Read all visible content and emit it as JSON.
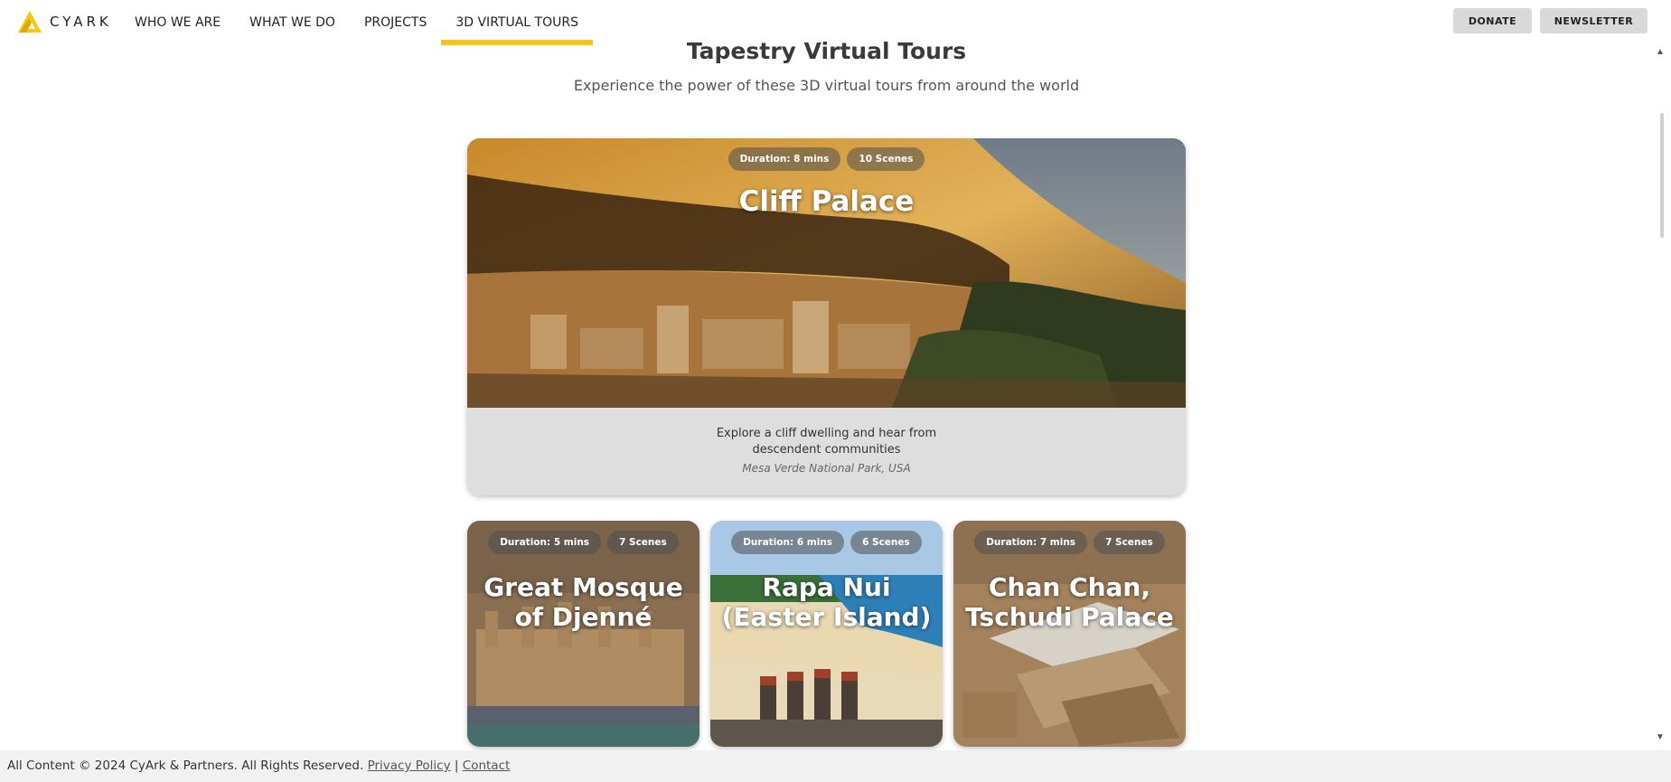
{
  "brand": {
    "name": "CYARK",
    "accent": "#f5c518"
  },
  "nav": {
    "items": [
      {
        "label": "WHO WE ARE"
      },
      {
        "label": "WHAT WE DO"
      },
      {
        "label": "PROJECTS"
      },
      {
        "label": "3D VIRTUAL TOURS",
        "active": true
      }
    ]
  },
  "header_buttons": {
    "donate": "DONATE",
    "newsletter": "NEWSLETTER"
  },
  "page": {
    "title": "Tapestry Virtual Tours",
    "subtitle": "Experience the power of these 3D virtual tours from around the world"
  },
  "featured": {
    "duration": "Duration: 8 mins",
    "scenes": "10 Scenes",
    "title": "Cliff Palace",
    "description_line1": "Explore a cliff dwelling and hear from",
    "description_line2": "descendent communities",
    "location": "Mesa Verde National Park, USA"
  },
  "tours": [
    {
      "duration": "Duration: 5 mins",
      "scenes": "7 Scenes",
      "title_line1": "Great Mosque",
      "title_line2": "of Djenné"
    },
    {
      "duration": "Duration: 6 mins",
      "scenes": "6 Scenes",
      "title_line1": "Rapa Nui",
      "title_line2": "(Easter Island)"
    },
    {
      "duration": "Duration: 7 mins",
      "scenes": "7 Scenes",
      "title_line1": "Chan Chan,",
      "title_line2": "Tschudi Palace"
    }
  ],
  "footer": {
    "copyright": "All Content © 2024 CyArk & Partners. All Rights Reserved.",
    "privacy": "Privacy Policy",
    "separator": "|",
    "contact": "Contact"
  }
}
